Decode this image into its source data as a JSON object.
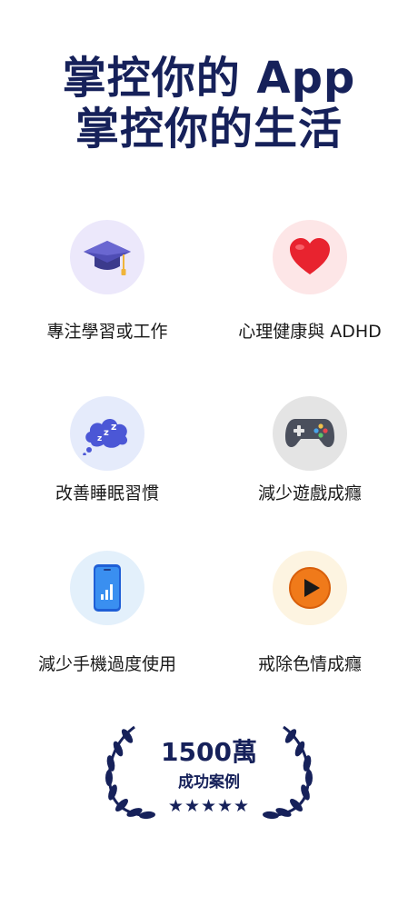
{
  "headline": {
    "line1": "掌控你的 App",
    "line2": "掌控你的生活"
  },
  "features": [
    {
      "label": "專注學習或工作",
      "icon": "graduation-cap-icon",
      "bg": "#ece8fb"
    },
    {
      "label": "心理健康與 ADHD",
      "icon": "heart-icon",
      "bg": "#fde6e7"
    },
    {
      "label": "改善睡眠習慣",
      "icon": "sleep-cloud-icon",
      "bg": "#e5ebfb"
    },
    {
      "label": "減少遊戲成癮",
      "icon": "game-controller-icon",
      "bg": "#e4e4e4"
    },
    {
      "label": "減少手機過度使用",
      "icon": "smartphone-icon",
      "bg": "#e3f0fb"
    },
    {
      "label": "戒除色情成癮",
      "icon": "play-button-icon",
      "bg": "#fdf4e1"
    }
  ],
  "badge": {
    "count": "1500萬",
    "caption": "成功案例",
    "stars": "★★★★★",
    "rating": 5
  },
  "colors": {
    "brand_navy": "#16215a"
  }
}
